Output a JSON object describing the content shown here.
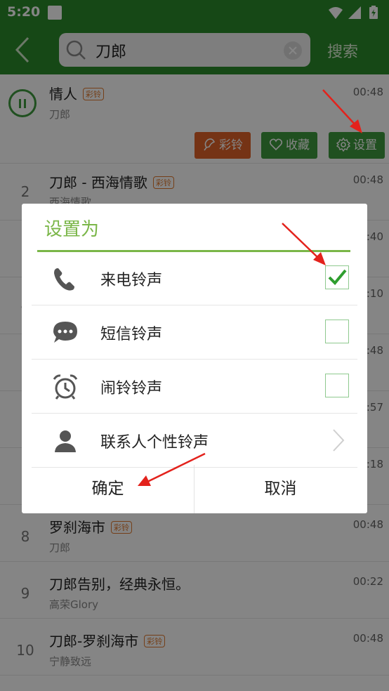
{
  "status_bar": {
    "time": "5:20"
  },
  "search": {
    "query": "刀郎",
    "button_label": "搜索"
  },
  "songs": [
    {
      "num": "",
      "title": "情人",
      "tag": "彩铃",
      "artist": "刀郎",
      "duration": "00:48"
    },
    {
      "num": "2",
      "title": "刀郎 - 西海情歌",
      "tag": "彩铃",
      "artist": "西海情歌",
      "duration": "00:48"
    },
    {
      "num": "3",
      "title": "",
      "tag": "",
      "artist": "",
      "duration": ":40"
    },
    {
      "num": "4",
      "title": "",
      "tag": "",
      "artist": "",
      "duration": ":10"
    },
    {
      "num": "5",
      "title": "",
      "tag": "",
      "artist": "",
      "duration": ":48"
    },
    {
      "num": "6",
      "title": "",
      "tag": "",
      "artist": "",
      "duration": ":57"
    },
    {
      "num": "7",
      "title": "",
      "tag": "",
      "artist": "",
      "duration": ":18"
    },
    {
      "num": "8",
      "title": "罗刹海市",
      "tag": "彩铃",
      "artist": "刀郎",
      "duration": "00:48"
    },
    {
      "num": "9",
      "title": "刀郎告别，经典永恒。",
      "tag": "",
      "artist": "高荣Glory",
      "duration": "00:22"
    },
    {
      "num": "10",
      "title": "刀郎-罗刹海市",
      "tag": "彩铃",
      "artist": "宁静致远",
      "duration": "00:48"
    }
  ],
  "song_actions": {
    "ringback": "彩铃",
    "favorite": "收藏",
    "settings": "设置"
  },
  "dialog": {
    "title": "设置为",
    "options": [
      {
        "label": "来电铃声",
        "icon": "phone-icon",
        "checked": true
      },
      {
        "label": "短信铃声",
        "icon": "message-icon",
        "checked": false
      },
      {
        "label": "闹铃铃声",
        "icon": "alarm-clock-icon",
        "checked": false
      },
      {
        "label": "联系人个性铃声",
        "icon": "contact-icon"
      }
    ],
    "confirm": "确定",
    "cancel": "取消"
  },
  "colors": {
    "app_green": "#2b8a2b",
    "dialog_accent": "#7ab648",
    "ringback_orange": "#e0622a",
    "action_green": "#3f9a3f",
    "annotation_red": "#e3221c"
  }
}
